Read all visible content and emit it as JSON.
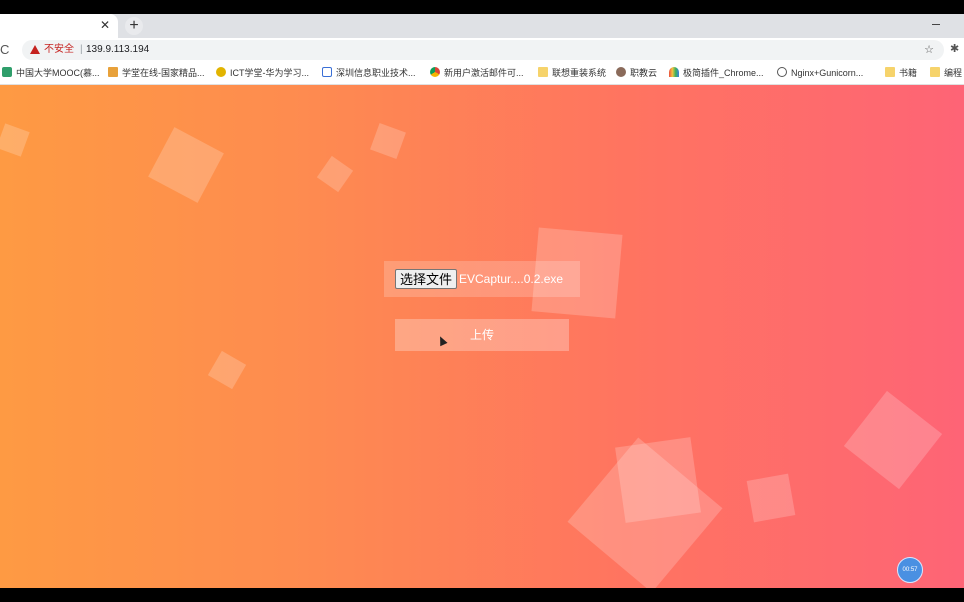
{
  "browser": {
    "tab_close_glyph": "✕",
    "new_tab_glyph": "+",
    "toolbar": {
      "reload_glyph": "C",
      "security_warning": "不安全",
      "url_separator": "|",
      "url": "139.9.113.194",
      "star_glyph": "☆",
      "extensions_glyph": "✱"
    },
    "bookmarks": [
      {
        "label": "中国大学MOOC(慕...",
        "icon": "mooc-icon"
      },
      {
        "label": "学堂在线-国家精品...",
        "icon": "xuetang-icon"
      },
      {
        "label": "ICT学堂-华为学习...",
        "icon": "ict-icon"
      },
      {
        "label": "深圳信息职业技术...",
        "icon": "school-icon"
      },
      {
        "label": "新用户激活邮件可...",
        "icon": "chrome-icon"
      },
      {
        "label": "联想重装系统",
        "icon": "folder-icon"
      },
      {
        "label": "职教云",
        "icon": "cloud-icon"
      },
      {
        "label": "极简插件_Chrome...",
        "icon": "rainbow-icon"
      },
      {
        "label": "Nginx+Gunicorn...",
        "icon": "globe-icon"
      },
      {
        "label": "书籍",
        "icon": "folder-icon"
      },
      {
        "label": "编程",
        "icon": "folder-icon"
      }
    ]
  },
  "page": {
    "file_button_label": "选择文件",
    "selected_file_name": "EVCaptur....0.2.exe",
    "upload_button_label": "上传"
  },
  "recorder": {
    "time": "00:57"
  },
  "colors": {
    "gradient_left": "#fe9a43",
    "gradient_right": "#fe6476",
    "warning_red": "#c5221f",
    "recorder_blue": "#4a90e2"
  }
}
